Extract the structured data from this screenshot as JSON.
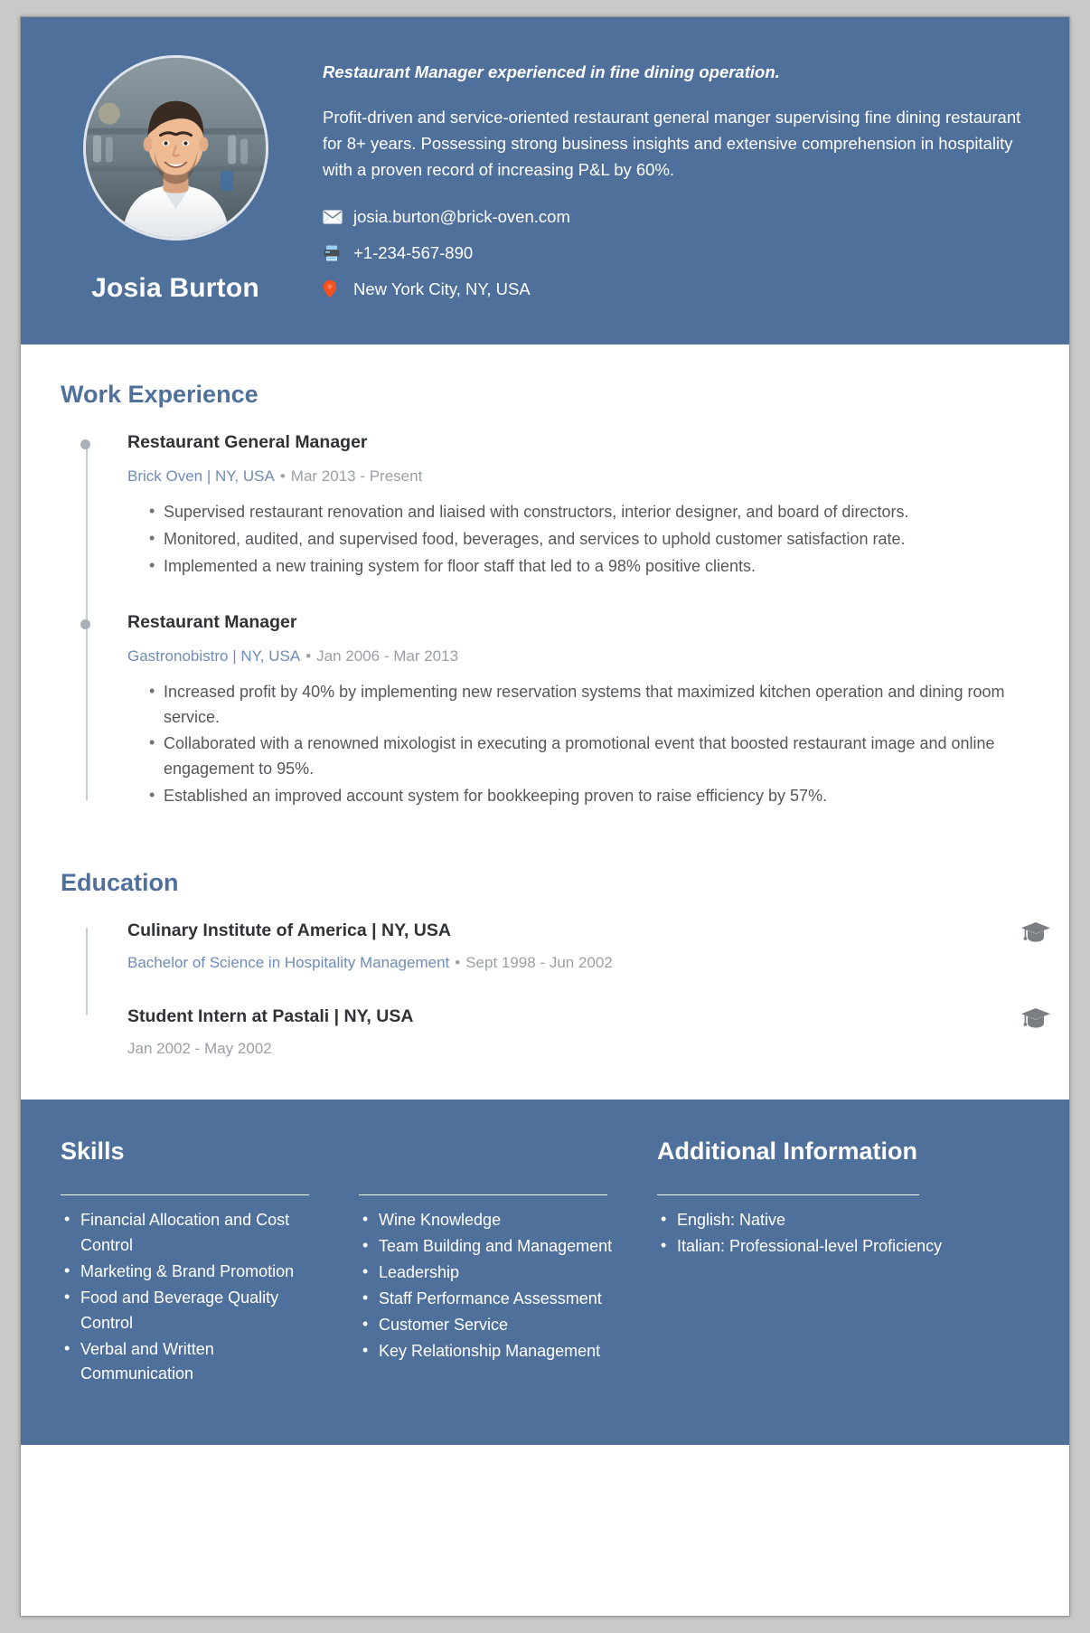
{
  "header": {
    "name": "Josia Burton",
    "tagline": "Restaurant Manager experienced in fine dining operation.",
    "summary": "Profit-driven and service-oriented restaurant general manger supervising fine dining restaurant for 8+ years. Possessing strong business insights and extensive comprehension in hospitality with a proven record of increasing P&L by 60%.",
    "contacts": [
      {
        "icon": "envelope-icon",
        "glyph": "✉",
        "value": "josia.burton@brick-oven.com"
      },
      {
        "icon": "fax-icon",
        "glyph": "🖶",
        "value": "+1-234-567-890"
      },
      {
        "icon": "location-pin-icon",
        "glyph": "📍",
        "value": "New York City, NY, USA"
      }
    ],
    "avatar_alt": "profile-photo"
  },
  "work": {
    "title": "Work Experience",
    "entries": [
      {
        "role": "Restaurant General Manager",
        "org": "Brick Oven | NY, USA",
        "separator": "•",
        "dates": "Mar 2013 - Present",
        "bullets": [
          "Supervised restaurant renovation and liaised with constructors, interior designer, and board of directors.",
          "Monitored, audited, and supervised food, beverages, and services to uphold customer satisfaction rate.",
          "Implemented a new training system for floor staff that led to a 98% positive clients."
        ]
      },
      {
        "role": "Restaurant Manager",
        "org": "Gastronobistro | NY, USA",
        "separator": "•",
        "dates": "Jan 2006 - Mar 2013",
        "bullets": [
          "Increased profit by 40% by implementing new reservation systems that maximized kitchen operation and dining room service.",
          "Collaborated with a renowned mixologist in executing a promotional event that boosted restaurant image and online engagement to 95%.",
          "Established an improved account system for bookkeeping proven to raise efficiency by 57%."
        ]
      }
    ]
  },
  "education": {
    "title": "Education",
    "entries": [
      {
        "school": "Culinary Institute of America | NY, USA",
        "degree": "Bachelor of Science in Hospitality Management",
        "separator": "•",
        "dates": "Sept 1998 - Jun 2002",
        "icon": "graduation-cap-icon"
      },
      {
        "school": "Student Intern at Pastali | NY, USA",
        "degree": "",
        "separator": "",
        "dates": "Jan 2002 - May 2002",
        "icon": "graduation-cap-icon"
      }
    ]
  },
  "skills": {
    "title": "Skills",
    "column1": [
      "Financial Allocation and Cost Control",
      "Marketing & Brand Promotion",
      "Food and Beverage Quality Control",
      "Verbal and Written Communication"
    ],
    "column2": [
      "Wine Knowledge",
      "Team Building and Management",
      "Leadership",
      "Staff Performance Assessment",
      "Customer Service",
      "Key Relationship Management"
    ]
  },
  "additional": {
    "title": "Additional Information",
    "items": [
      "English: Native",
      "Italian: Professional-level Proficiency"
    ]
  },
  "colors": {
    "brand_blue": "#4f709a",
    "heading_blue": "#4f709a",
    "org_blue": "#6f8cb5",
    "muted_gray": "#9aa0a6",
    "body_gray": "#54585c",
    "page_bg": "#c9c9c9",
    "pin_red": "#f4511e"
  }
}
